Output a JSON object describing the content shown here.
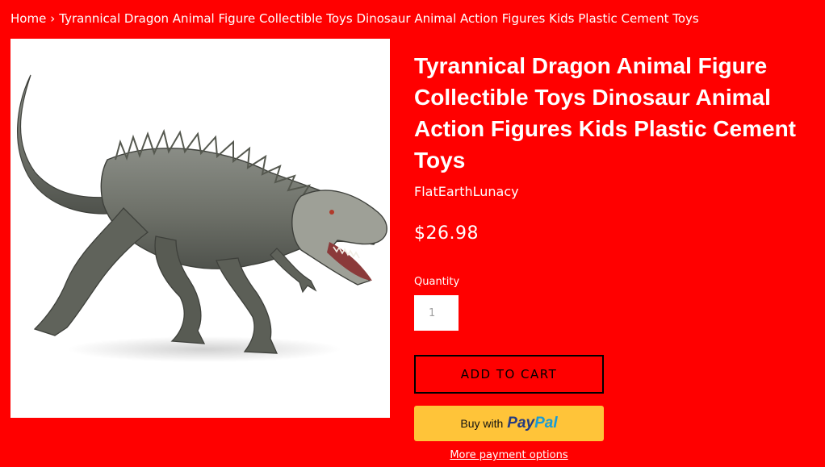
{
  "breadcrumb": {
    "home": "Home",
    "separator": "›",
    "current": "Tyrannical Dragon Animal Figure Collectible Toys Dinosaur Animal Action Figures Kids Plastic Cement Toys"
  },
  "product": {
    "title": "Tyrannical Dragon Animal Figure Collectible Toys Dinosaur Animal Action Figures Kids Plastic Cement Toys",
    "vendor": "FlatEarthLunacy",
    "price": "$26.98",
    "image_icon": "dinosaur-figure-image"
  },
  "quantity": {
    "label": "Quantity",
    "value": "1"
  },
  "buttons": {
    "add_to_cart": "ADD TO CART",
    "paypal_prefix": "Buy with",
    "paypal_pay": "Pay",
    "paypal_pal": "Pal",
    "more_payment_options": "More payment options"
  },
  "colors": {
    "page_background": "#ff0000",
    "text": "#ffffff",
    "paypal_yellow": "#ffc439",
    "paypal_dark_blue": "#253b80",
    "paypal_light_blue": "#179bd7",
    "add_to_cart_border": "#000000"
  }
}
